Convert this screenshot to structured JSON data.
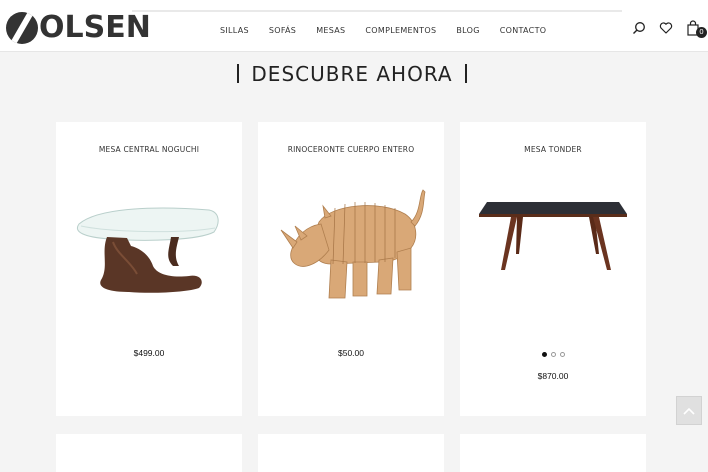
{
  "brand": {
    "name": "OLSEN"
  },
  "nav": {
    "items": [
      {
        "label": "SILLAS"
      },
      {
        "label": "SOFÁS"
      },
      {
        "label": "MESAS"
      },
      {
        "label": "COMPLEMENTOS"
      },
      {
        "label": "BLOG"
      },
      {
        "label": "CONTACTO"
      }
    ]
  },
  "header_icons": {
    "search": "search-icon",
    "wishlist": "heart-icon",
    "cart": "shopping-bag-icon",
    "cart_count": "0"
  },
  "section": {
    "title": "DESCUBRE AHORA"
  },
  "products": [
    {
      "name": "MESA CENTRAL NOGUCHI",
      "price": "$499.00"
    },
    {
      "name": "RINOCERONTE CUERPO ENTERO",
      "price": "$50.00"
    },
    {
      "name": "MESA TONDER",
      "price": "$870.00",
      "carousel_active": 1,
      "carousel_total": 3
    }
  ],
  "back_to_top": {
    "icon": "chevron-up-icon"
  }
}
